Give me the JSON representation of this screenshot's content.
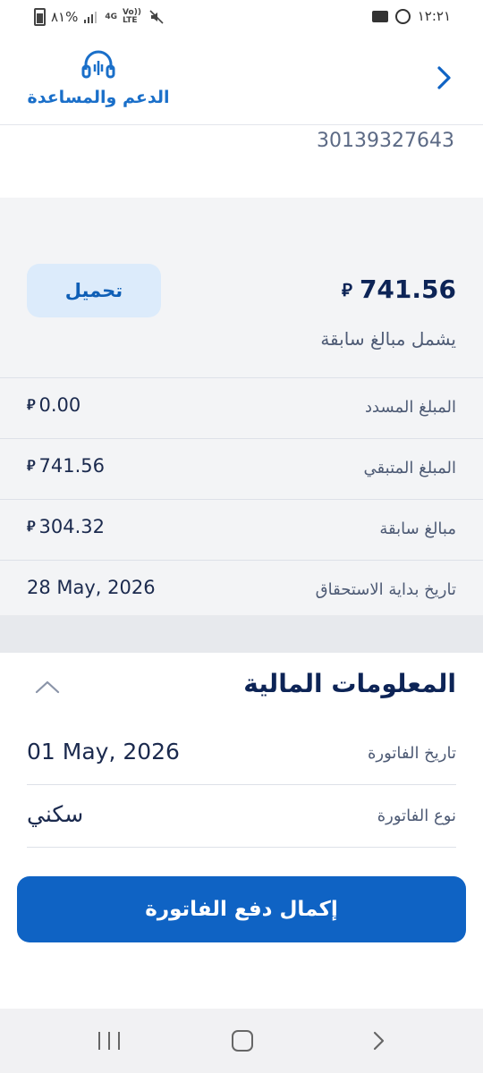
{
  "status_bar": {
    "battery": "٨١%",
    "network": "4G",
    "volte": "Vo))\nLTE",
    "time": "١٢:٢١"
  },
  "header": {
    "support_label": "الدعم والمساعدة",
    "back_icon": "chevron-right-icon",
    "support_icon": "headset-icon"
  },
  "bill": {
    "reference_number": "30139327643",
    "total_amount": "741.56",
    "currency_symbol": "⃁",
    "download_label": "تحميل",
    "includes_note": "يشمل مبالغ سابقة"
  },
  "summary_rows": [
    {
      "label": "المبلغ المسدد",
      "value": "0.00",
      "has_currency": true
    },
    {
      "label": "المبلغ المتبقي",
      "value": "741.56",
      "has_currency": true
    },
    {
      "label": "مبالغ سابقة",
      "value": "304.32",
      "has_currency": true
    },
    {
      "label": "تاريخ بداية الاستحقاق",
      "value": "28 May, 2026",
      "has_currency": false
    }
  ],
  "financial_info": {
    "title": "المعلومات المالية",
    "rows": [
      {
        "label": "تاريخ الفاتورة",
        "value": "01 May, 2026"
      },
      {
        "label": "نوع الفاتورة",
        "value": "سكني"
      }
    ],
    "pay_button": "إكمال دفع الفاتورة"
  },
  "colors": {
    "primary": "#0f63c4",
    "navy": "#0d2456",
    "summary_bg": "#f3f4f6",
    "download_bg": "#dcebfb"
  }
}
